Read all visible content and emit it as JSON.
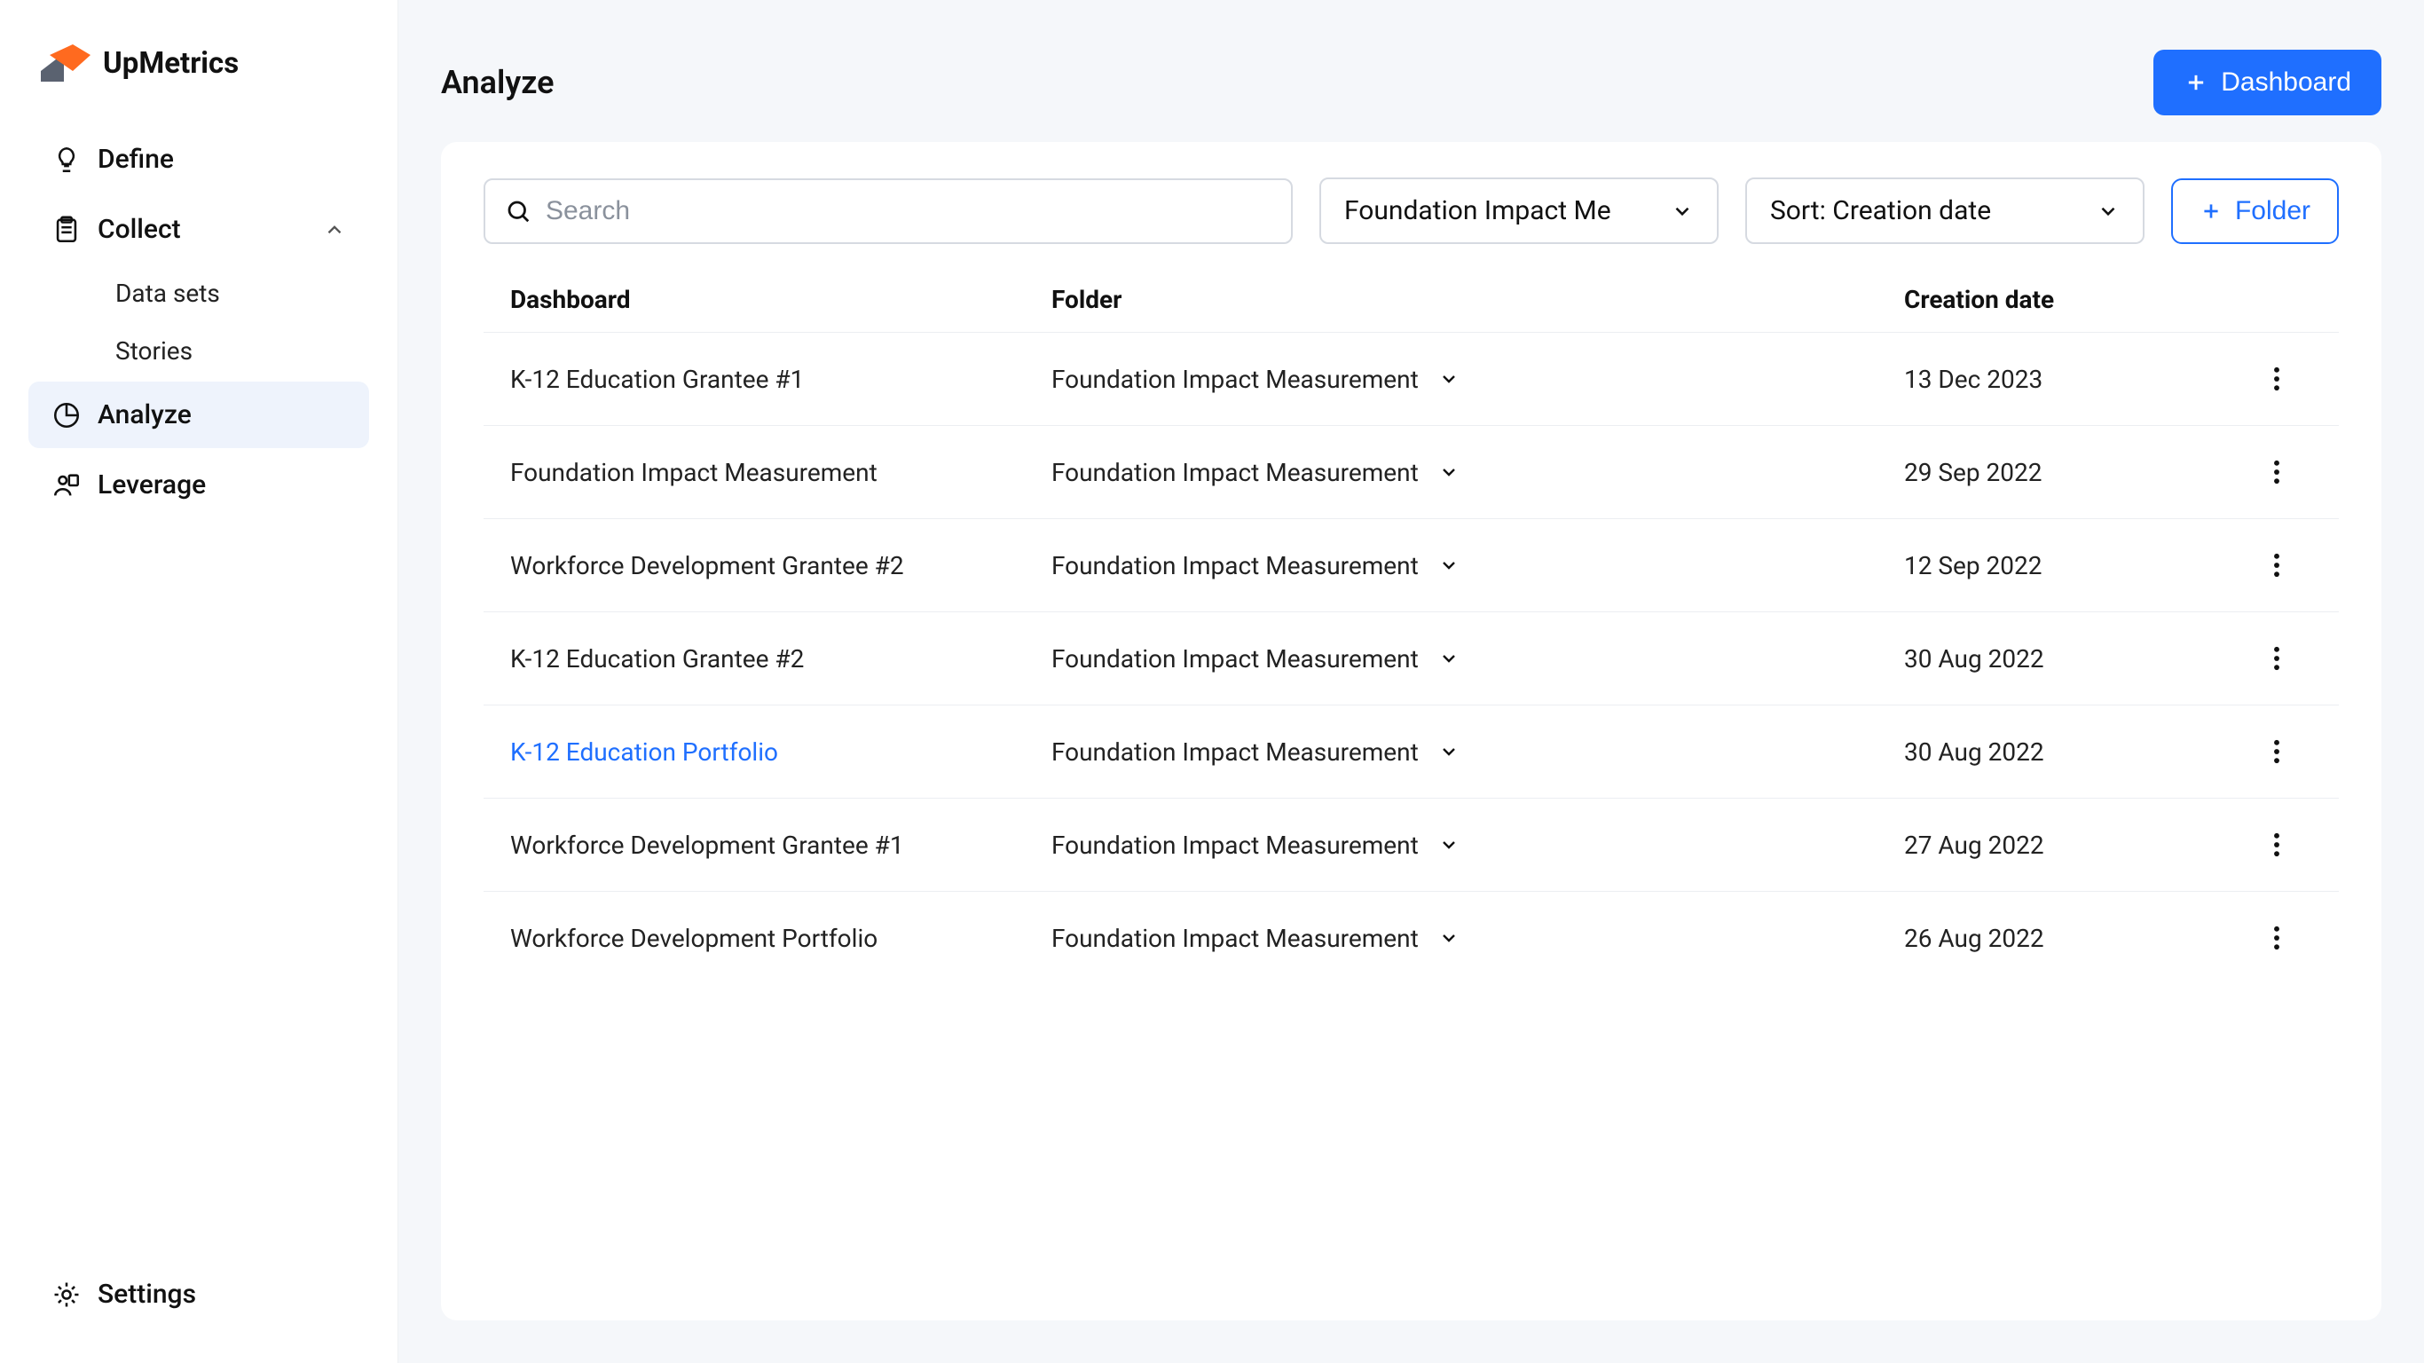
{
  "brand": {
    "name": "UpMetrics"
  },
  "sidebar": {
    "items": [
      {
        "label": "Define"
      },
      {
        "label": "Collect"
      },
      {
        "label": "Analyze"
      },
      {
        "label": "Leverage"
      }
    ],
    "collect_sub": [
      {
        "label": "Data sets"
      },
      {
        "label": "Stories"
      }
    ],
    "settings_label": "Settings"
  },
  "header": {
    "title": "Analyze",
    "dashboard_button": "Dashboard"
  },
  "controls": {
    "search_placeholder": "Search",
    "filter_label": "Foundation Impact Me",
    "sort_label": "Sort: Creation date",
    "folder_button": "Folder"
  },
  "table": {
    "headers": {
      "dashboard": "Dashboard",
      "folder": "Folder",
      "created": "Creation date"
    },
    "rows": [
      {
        "name": "K-12 Education Grantee #1",
        "folder": "Foundation Impact Measurement",
        "created": "13 Dec 2023",
        "highlight": false
      },
      {
        "name": "Foundation Impact Measurement",
        "folder": "Foundation Impact Measurement",
        "created": "29 Sep 2022",
        "highlight": false
      },
      {
        "name": "Workforce Development Grantee #2",
        "folder": "Foundation Impact Measurement",
        "created": "12 Sep 2022",
        "highlight": false
      },
      {
        "name": "K-12 Education Grantee #2",
        "folder": "Foundation Impact Measurement",
        "created": "30 Aug 2022",
        "highlight": false
      },
      {
        "name": "K-12 Education Portfolio",
        "folder": "Foundation Impact Measurement",
        "created": "30 Aug 2022",
        "highlight": true
      },
      {
        "name": "Workforce Development Grantee #1",
        "folder": "Foundation Impact Measurement",
        "created": "27 Aug 2022",
        "highlight": false
      },
      {
        "name": "Workforce Development Portfolio",
        "folder": "Foundation Impact Measurement",
        "created": "26 Aug 2022",
        "highlight": false
      }
    ]
  }
}
